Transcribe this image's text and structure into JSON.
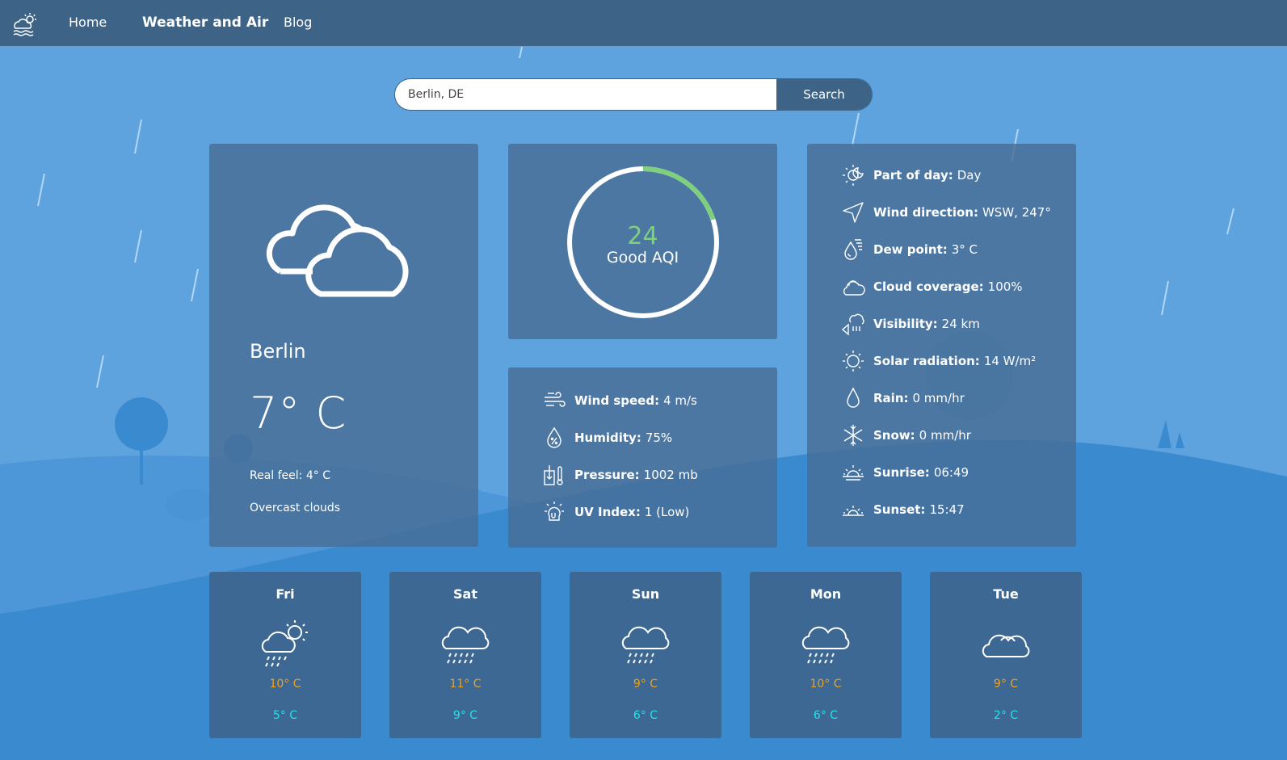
{
  "nav": {
    "logo_icon": "weather-logo-icon",
    "items": [
      {
        "label": "Home",
        "active": false
      },
      {
        "label": "Weather and Air",
        "active": true
      },
      {
        "label": "Blog",
        "active": false
      }
    ]
  },
  "search": {
    "value": "Berlin, DE",
    "button_label": "Search"
  },
  "current": {
    "icon": "overcast-clouds-icon",
    "city": "Berlin",
    "temperature": "7° C",
    "real_feel": "Real feel: 4° C",
    "description": "Overcast clouds"
  },
  "aqi": {
    "value": "24",
    "label": "Good AQI",
    "fraction": 0.2,
    "color": "#7ed07e"
  },
  "stats": [
    {
      "icon": "wind-icon",
      "label": "Wind speed:",
      "value": "4 m/s"
    },
    {
      "icon": "humidity-icon",
      "label": "Humidity:",
      "value": "75%"
    },
    {
      "icon": "pressure-icon",
      "label": "Pressure:",
      "value": "1002 mb"
    },
    {
      "icon": "uv-index-icon",
      "label": "UV Index:",
      "value": "1 (Low)"
    }
  ],
  "details": [
    {
      "icon": "part-of-day-icon",
      "label": "Part of day:",
      "value": "Day"
    },
    {
      "icon": "wind-direction-icon",
      "label": "Wind direction:",
      "value": "WSW, 247°"
    },
    {
      "icon": "dew-point-icon",
      "label": "Dew point:",
      "value": "3° C"
    },
    {
      "icon": "cloud-coverage-icon",
      "label": "Cloud coverage:",
      "value": "100%"
    },
    {
      "icon": "visibility-icon",
      "label": "Visibility:",
      "value": "24 km"
    },
    {
      "icon": "solar-radiation-icon",
      "label": "Solar radiation:",
      "value": "14 W/m²"
    },
    {
      "icon": "rain-icon",
      "label": "Rain:",
      "value": "0 mm/hr"
    },
    {
      "icon": "snow-icon",
      "label": "Snow:",
      "value": "0 mm/hr"
    },
    {
      "icon": "sunrise-icon",
      "label": "Sunrise:",
      "value": "06:49"
    },
    {
      "icon": "sunset-icon",
      "label": "Sunset:",
      "value": "15:47"
    }
  ],
  "forecast": [
    {
      "day": "Fri",
      "icon": "sun-cloud-rain-icon",
      "high": "10° C",
      "low": "5° C"
    },
    {
      "day": "Sat",
      "icon": "cloud-rain-icon",
      "high": "11° C",
      "low": "9° C"
    },
    {
      "day": "Sun",
      "icon": "cloud-rain-icon",
      "high": "9° C",
      "low": "6° C"
    },
    {
      "day": "Mon",
      "icon": "cloud-rain-icon",
      "high": "10° C",
      "low": "6° C"
    },
    {
      "day": "Tue",
      "icon": "cloud-icon",
      "high": "9° C",
      "low": "2° C"
    }
  ],
  "colors": {
    "nav": "#3d6487",
    "sky": "#5aa1dc",
    "hill": "#3f8fd4",
    "high_temp": "#f0a020",
    "low_temp": "#22e3e8"
  }
}
